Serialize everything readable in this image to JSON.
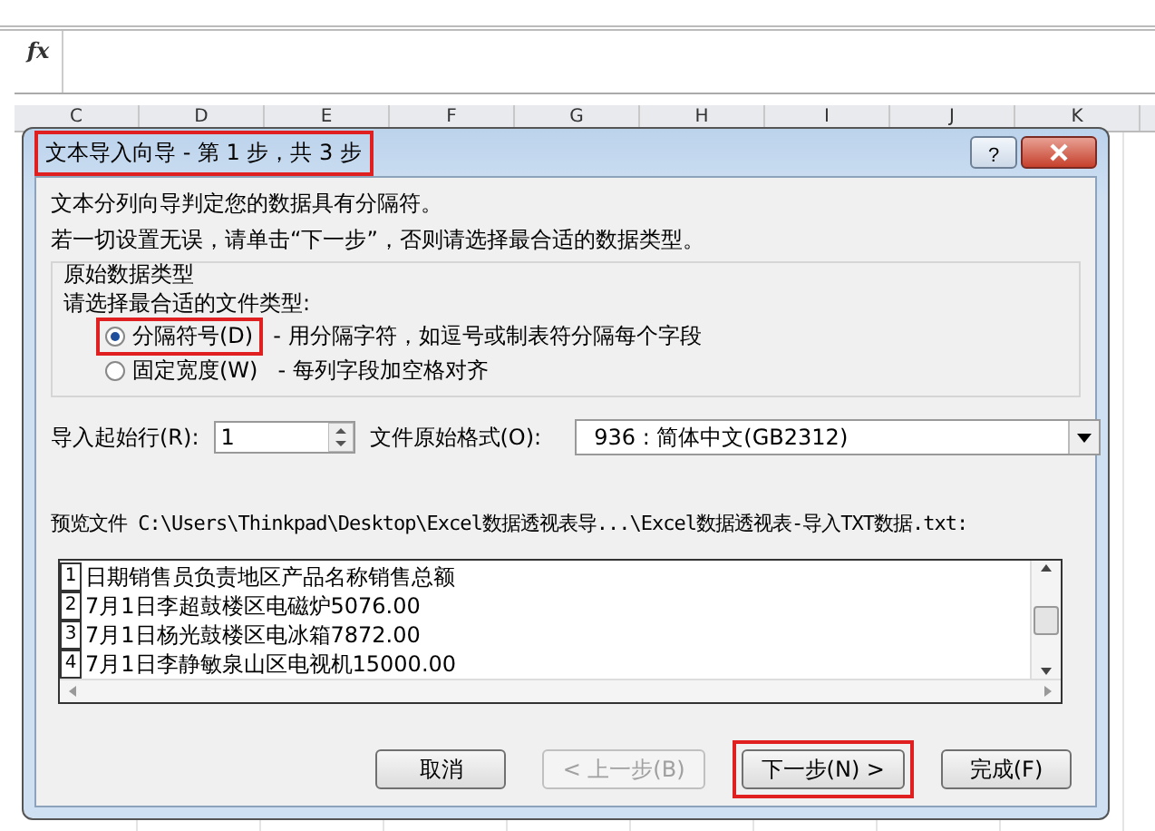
{
  "formula_bar": {
    "fx_label": "fx"
  },
  "columns": [
    "C",
    "D",
    "E",
    "F",
    "G",
    "H",
    "I",
    "J",
    "K"
  ],
  "dialog": {
    "title": "文本导入向导 - 第 1 步，共 3 步",
    "title_highlighted": true,
    "help_button": "?",
    "intro": [
      "文本分列向导判定您的数据具有分隔符。",
      "若一切设置无误，请单击“下一步”，否则请选择最合适的数据类型。"
    ],
    "group_title": "原始数据类型",
    "group_prompt": "请选择最合适的文件类型:",
    "options": [
      {
        "label": "分隔符号(D)",
        "description": "- 用分隔字符，如逗号或制表符分隔每个字段",
        "selected": true,
        "highlighted": true
      },
      {
        "label": "固定宽度(W)",
        "description": "- 每列字段加空格对齐",
        "selected": false,
        "highlighted": false
      }
    ],
    "start_row": {
      "label": "导入起始行(R):",
      "value": "1"
    },
    "origin": {
      "label": "文件原始格式(O):",
      "value": "936 : 简体中文(GB2312)"
    },
    "preview_label": "预览文件 C:\\Users\\Thinkpad\\Desktop\\Excel数据透视表导...\\Excel数据透视表-导入TXT数据.txt:",
    "preview_rows": [
      {
        "number": "1",
        "text": "日期销售员负责地区产品名称销售总额"
      },
      {
        "number": "2",
        "text": "7月1日李超鼓楼区电磁炉5076.00"
      },
      {
        "number": "3",
        "text": "7月1日杨光鼓楼区电冰箱7872.00"
      },
      {
        "number": "4",
        "text": "7月1日李静敏泉山区电视机15000.00"
      }
    ],
    "buttons": [
      {
        "label": "取消",
        "disabled": false,
        "highlighted": false
      },
      {
        "label": "< 上一步(B)",
        "disabled": true,
        "highlighted": false
      },
      {
        "label": "下一步(N) >",
        "disabled": false,
        "highlighted": true
      },
      {
        "label": "完成(F)",
        "disabled": false,
        "highlighted": false
      }
    ]
  }
}
